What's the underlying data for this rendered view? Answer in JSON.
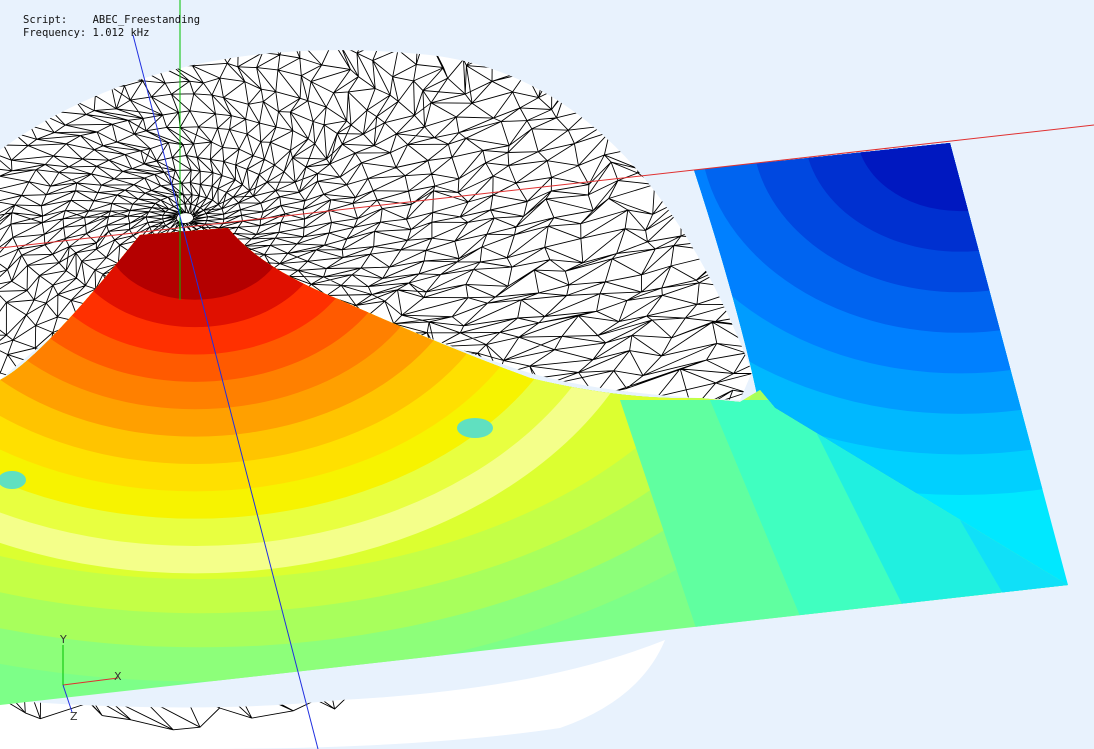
{
  "info": {
    "script_label": "Script:",
    "script_value": "ABEC_Freestanding",
    "frequency_label": "Frequency:",
    "frequency_value": "1.012 kHz"
  },
  "triad": {
    "x_label": "X",
    "y_label": "Y",
    "z_label": "Z"
  },
  "colors": {
    "background": "#e8f2fd",
    "mesh_line": "#000000",
    "axis_x": "#e03030",
    "axis_y": "#00c000",
    "axis_z": "#2030e0"
  },
  "field_map": {
    "palette": "jet",
    "scale_low_color": "#0010c8",
    "scale_high_color": "#a00000"
  }
}
